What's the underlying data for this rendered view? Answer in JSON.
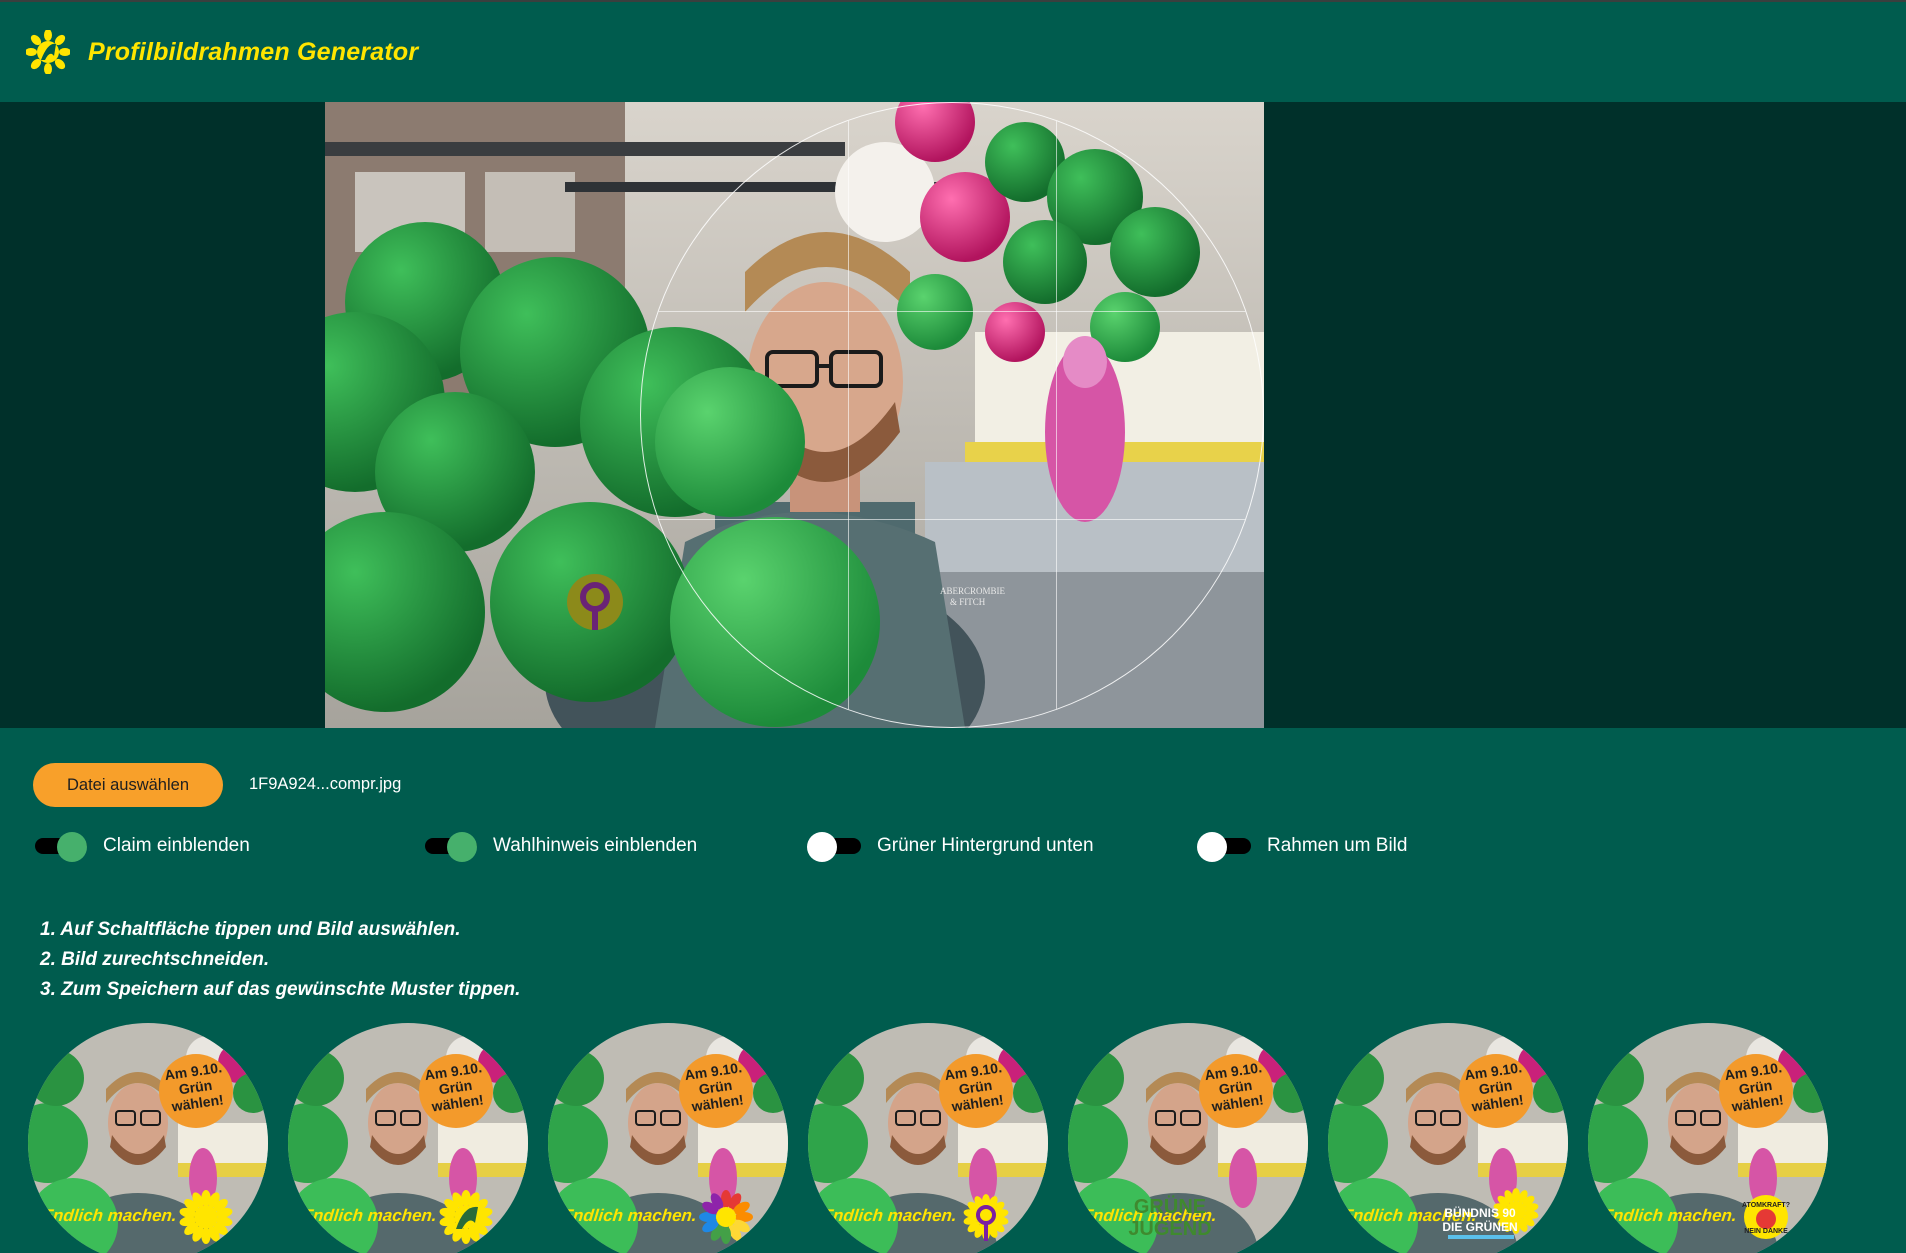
{
  "header": {
    "title": "Profilbildrahmen Generator",
    "logo_icon": "sunflower-logo-icon"
  },
  "colors": {
    "background": "#005c4e",
    "stage": "#00302a",
    "title": "#ffe500",
    "button": "#f8a02a",
    "toggle_on": "#46b06c"
  },
  "file": {
    "button_label": "Datei auswählen",
    "file_name": "1F9A924...compr.jpg"
  },
  "toggles": [
    {
      "label": "Claim einblenden",
      "on": true
    },
    {
      "label": "Wahlhinweis einblenden",
      "on": true
    },
    {
      "label": "Grüner Hintergrund unten",
      "on": false
    },
    {
      "label": "Rahmen um Bild",
      "on": false
    }
  ],
  "instructions": [
    "1. Auf Schaltfläche tippen und Bild auswählen.",
    "2. Bild zurechtschneiden.",
    "3. Zum Speichern auf das gewünschte Muster tippen."
  ],
  "thumbnails": {
    "badge_lines": [
      "Am 9.10.",
      "Grün",
      "wählen!"
    ],
    "claim": "Endlich machen.",
    "items": [
      {
        "logo": "sunflower-icon"
      },
      {
        "logo": "sunflower-logo-icon"
      },
      {
        "logo": "rainbow-sunflower-icon"
      },
      {
        "logo": "women-symbol-sunflower-icon"
      },
      {
        "logo": "gruene-jugend-icon",
        "logo_text": [
          "GRÜNE",
          "JUGEND"
        ]
      },
      {
        "logo": "buendnis-90-die-gruenen-icon",
        "logo_text": [
          "BÜNDNIS 90",
          "DIE GRÜNEN"
        ]
      },
      {
        "logo": "atomkraft-nein-danke-icon",
        "logo_text": [
          "ATOMKRAFT?",
          "NEIN DANKE"
        ]
      }
    ]
  }
}
